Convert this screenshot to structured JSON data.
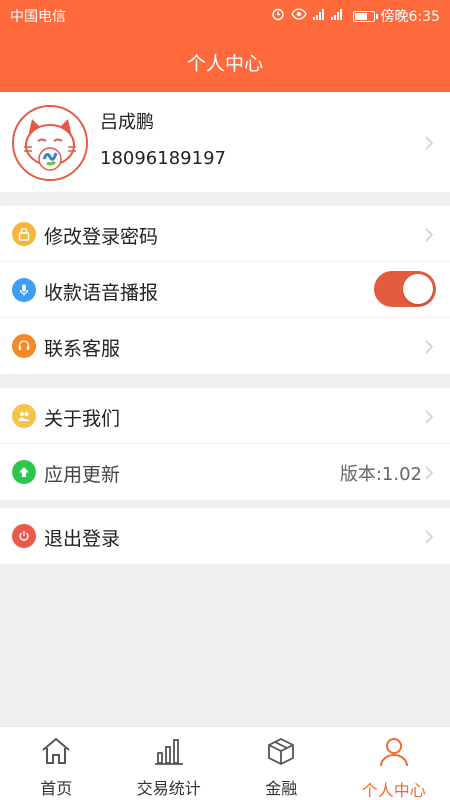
{
  "status_bar": {
    "carrier": "中国电信",
    "time": "傍晚6:35"
  },
  "header": {
    "title": "个人中心"
  },
  "profile": {
    "name": "吕成鹏",
    "phone": "18096189197"
  },
  "settings": {
    "group1": [
      {
        "label": "修改登录密码",
        "icon": "lock-icon",
        "color": "#f5b83f"
      },
      {
        "label": "收款语音播报",
        "icon": "microphone-icon",
        "color": "#3d9df1",
        "toggle": true
      },
      {
        "label": "联系客服",
        "icon": "headset-icon",
        "color": "#f38a2a"
      }
    ],
    "group2": [
      {
        "label": "关于我们",
        "icon": "people-icon",
        "color": "#f5c24a"
      },
      {
        "label": "应用更新",
        "icon": "upload-arrow-icon",
        "color": "#2dc650",
        "value": "版本:1.02"
      }
    ],
    "group3": [
      {
        "label": "退出登录",
        "icon": "power-icon",
        "color": "#ea5a4c"
      }
    ]
  },
  "nav": {
    "items": [
      {
        "label": "首页",
        "icon": "home-icon"
      },
      {
        "label": "交易统计",
        "icon": "bar-chart-icon"
      },
      {
        "label": "金融",
        "icon": "cube-icon"
      },
      {
        "label": "个人中心",
        "icon": "person-icon",
        "active": true
      }
    ]
  },
  "colors": {
    "brand": "#ff6a3d",
    "toggle_on": "#e45b3e",
    "active_nav": "#f26a2f"
  }
}
